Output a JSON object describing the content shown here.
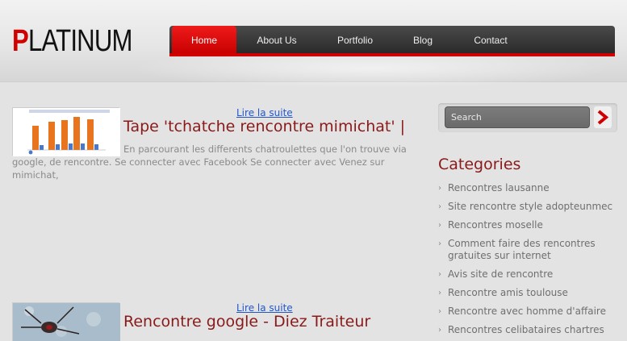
{
  "brand": {
    "first": "P",
    "rest": "LATINUM",
    "accent": "#d10000"
  },
  "nav": [
    {
      "label": "Home",
      "active": true
    },
    {
      "label": "About Us"
    },
    {
      "label": "Portfolio"
    },
    {
      "label": "Blog"
    },
    {
      "label": "Contact"
    }
  ],
  "posts": [
    {
      "readmore": "Lire la suite",
      "title": "Tape 'tchatche rencontre mimichat' |",
      "excerpt": "En parcourant les differents chatroulettes que l'on trouve via google, de rencontre. Se connecter avec Facebook Se connecter avec Venez sur mimichat,"
    },
    {
      "readmore": "Lire la suite",
      "title": "Rencontre google - Diez Traiteur",
      "excerpt": ""
    }
  ],
  "search": {
    "placeholder": "Search",
    "icon": "chevron-right-icon"
  },
  "categories": {
    "title": "Categories",
    "items": [
      "Rencontres lausanne",
      "Site rencontre style adopteunmec",
      "Rencontres moselle",
      "Comment faire des rencontres gratuites sur internet",
      "Avis site de rencontre",
      "Rencontre amis toulouse",
      "Rencontre avec homme d'affaire",
      "Rencontres celibataires chartres"
    ]
  }
}
